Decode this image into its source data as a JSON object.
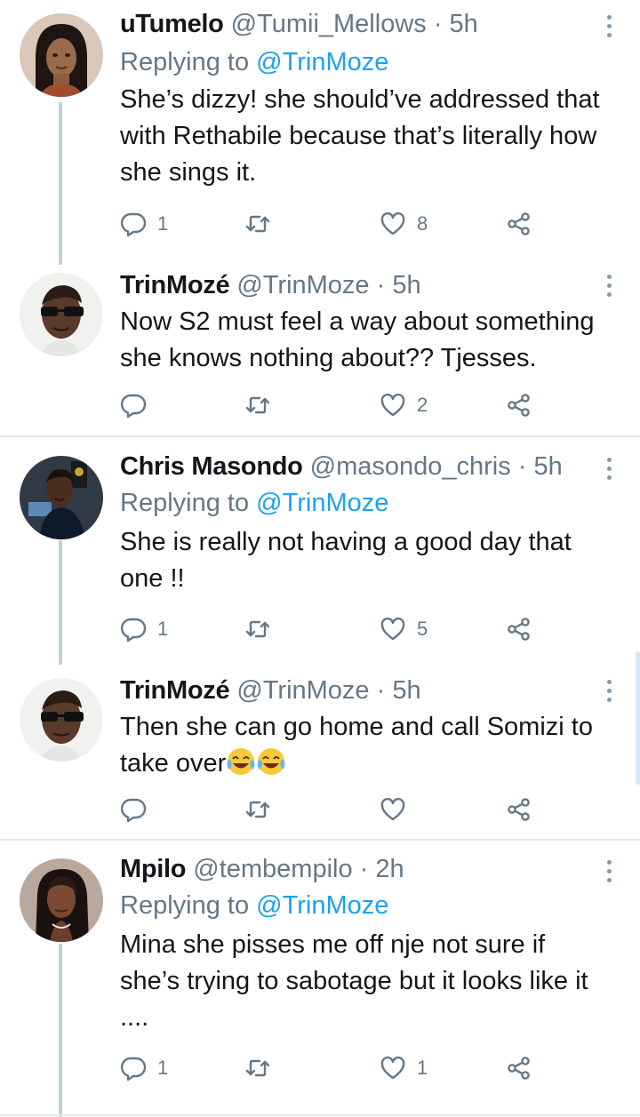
{
  "tweets": [
    {
      "name": "uTumelo",
      "handle": "@Tumii_Mellows",
      "time": "· 5h",
      "replying_prefix": "Replying to",
      "replying_to": "@TrinMoze",
      "text": "She’s dizzy! she should’ve addressed that with Rethabile because that’s literally how she sings it.",
      "replies": "1",
      "retweets": "",
      "likes": "8"
    },
    {
      "name": "TrinMozé",
      "handle": "@TrinMoze",
      "time": "· 5h",
      "text": "Now S2 must feel a way about something she knows nothing about?? Tjesses.",
      "replies": "",
      "retweets": "",
      "likes": "2"
    },
    {
      "name": "Chris Masondo",
      "handle": "@masondo_chris",
      "time": "· 5h",
      "replying_prefix": "Replying to",
      "replying_to": "@TrinMoze",
      "text": "She is really not having a good day that one !!",
      "replies": "1",
      "retweets": "",
      "likes": "5"
    },
    {
      "name": "TrinMozé",
      "handle": "@TrinMoze",
      "time": "· 5h",
      "text": "Then she can go home and call Somizi to take over",
      "emoji": "face-with-tears-of-joy x2",
      "replies": "",
      "retweets": "",
      "likes": ""
    },
    {
      "name": "Mpilo",
      "handle": "@tembempilo",
      "time": "· 2h",
      "replying_prefix": "Replying to",
      "replying_to": "@TrinMoze",
      "text": "Mina she pisses me off nje not sure if she’s trying to sabotage but it looks like it ....",
      "replies": "1",
      "retweets": "",
      "likes": "1"
    }
  ],
  "icons": {
    "reply": "reply-icon",
    "retweet": "retweet-icon",
    "like": "heart-icon",
    "share": "share-icon",
    "more": "more-vertical-icon"
  },
  "colors": {
    "link": "#1da1f2",
    "secondary_text": "#657786",
    "thread_line": "#c4cfd6",
    "divider": "#e1e8ed"
  }
}
